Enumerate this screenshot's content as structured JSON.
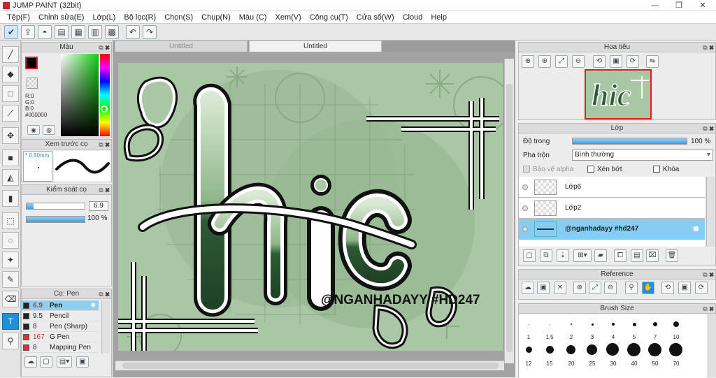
{
  "app": {
    "title": "JUMP PAINT (32bit)"
  },
  "window": {
    "minimize": "—",
    "maximize": "❐",
    "close": "✕"
  },
  "menu": [
    "Tệp(F)",
    "Chỉnh sửa(E)",
    "Lớp(L)",
    "Bộ lọc(R)",
    "Chọn(S)",
    "Chụp(N)",
    "Màu (C)",
    "Xem(V)",
    "Công cụ(T)",
    "Cửa sổ(W)",
    "Cloud",
    "Help"
  ],
  "tabs": [
    "Untitled",
    "Untitled"
  ],
  "color_panel": {
    "title": "Màu",
    "r": "R:0",
    "g": "G:0",
    "b": "B:0",
    "hex": "#000000"
  },
  "brush_preview": {
    "title": "Xem trước cọ",
    "size": "* 0.50mm"
  },
  "brush_control": {
    "title": "Kiểm soát cọ",
    "size": "6.9",
    "opacity": "100 %"
  },
  "brush_list": {
    "title": "Cọ: Pen",
    "items": [
      {
        "size": "6.9",
        "name": "Pen",
        "color": "#222222"
      },
      {
        "size": "9.5",
        "name": "Pencil",
        "color": "#222222"
      },
      {
        "size": "8",
        "name": "Pen (Sharp)",
        "color": "#222222"
      },
      {
        "size": "167",
        "name": "G Pen",
        "color": "#e03030"
      },
      {
        "size": "8",
        "name": "Mapping Pen",
        "color": "#e03030"
      }
    ]
  },
  "navigator": {
    "title": "Hoa tiêu"
  },
  "layer_panel": {
    "title": "Lớp",
    "opacity_label": "Độ trong",
    "opacity_value": "100 %",
    "blend_label": "Pha trộn",
    "blend_value": "Bình thường",
    "protect_alpha": "Bảo vệ alpha",
    "clipping": "Xén bớt",
    "lock": "Khóa",
    "layers": [
      "Lớp6",
      "Lớp2",
      "@nganhadayy #hd247"
    ]
  },
  "reference": {
    "title": "Reference"
  },
  "brush_size": {
    "title": "Brush Size",
    "sizes": [
      "1",
      "1.5",
      "2",
      "3",
      "4",
      "5",
      "7",
      "10",
      "12",
      "15",
      "20",
      "25",
      "30",
      "40",
      "50",
      "70"
    ]
  },
  "artwork": {
    "watermark": "@NGANHADAYY #HD247"
  },
  "colors": {
    "accent": "#1e90d8",
    "art_bg": "#a9c7a4",
    "art_dark": "#2f5a35"
  }
}
